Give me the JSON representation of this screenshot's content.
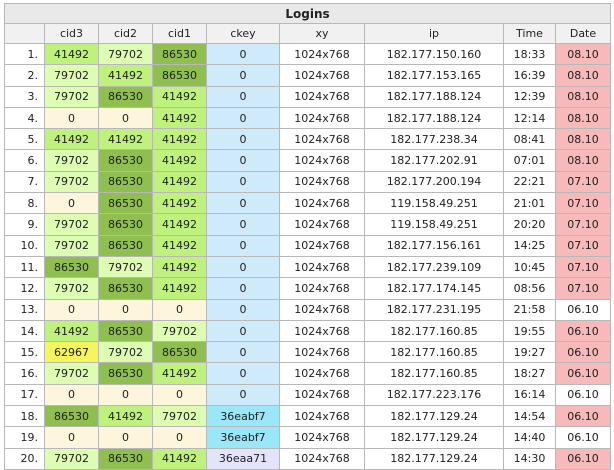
{
  "title": "Logins",
  "headers": [
    "",
    "cid3",
    "cid2",
    "cid1",
    "ckey",
    "xy",
    "ip",
    "Time",
    "Date"
  ],
  "colors": {
    "c86530": "#8fbf4f",
    "c41492": "#bff27c",
    "c79702": "#dcfdb2",
    "c62967": "#f6f65a",
    "c0": "#fdf6dd",
    "ckey": "#cfeafb",
    "ckey_36eabf7": "#99e7f9",
    "ckey_36eaa71": "#e3e3fb",
    "date_08": "#f7b9b9",
    "date_07": "#f7b9b9",
    "date_06_marked": "#f7b9b9"
  },
  "rows": [
    {
      "n": "1.",
      "cid3": "41492",
      "cid2": "79702",
      "cid1": "86530",
      "ckey": "0",
      "xy": "1024x768",
      "ip": "182.177.150.160",
      "time": "18:33",
      "date": "08.10",
      "date_marked": true
    },
    {
      "n": "2.",
      "cid3": "79702",
      "cid2": "41492",
      "cid1": "86530",
      "ckey": "0",
      "xy": "1024x768",
      "ip": "182.177.153.165",
      "time": "16:39",
      "date": "08.10",
      "date_marked": true
    },
    {
      "n": "3.",
      "cid3": "79702",
      "cid2": "86530",
      "cid1": "41492",
      "ckey": "0",
      "xy": "1024x768",
      "ip": "182.177.188.124",
      "time": "12:39",
      "date": "08.10",
      "date_marked": true
    },
    {
      "n": "4.",
      "cid3": "0",
      "cid2": "0",
      "cid1": "41492",
      "ckey": "0",
      "xy": "1024x768",
      "ip": "182.177.188.124",
      "time": "12:14",
      "date": "08.10",
      "date_marked": true
    },
    {
      "n": "5.",
      "cid3": "41492",
      "cid2": "41492",
      "cid1": "41492",
      "ckey": "0",
      "xy": "1024x768",
      "ip": "182.177.238.34",
      "time": "08:41",
      "date": "08.10",
      "date_marked": true
    },
    {
      "n": "6.",
      "cid3": "79702",
      "cid2": "86530",
      "cid1": "41492",
      "ckey": "0",
      "xy": "1024x768",
      "ip": "182.177.202.91",
      "time": "07:01",
      "date": "08.10",
      "date_marked": true
    },
    {
      "n": "7.",
      "cid3": "79702",
      "cid2": "86530",
      "cid1": "41492",
      "ckey": "0",
      "xy": "1024x768",
      "ip": "182.177.200.194",
      "time": "22:21",
      "date": "07.10",
      "date_marked": true
    },
    {
      "n": "8.",
      "cid3": "0",
      "cid2": "86530",
      "cid1": "41492",
      "ckey": "0",
      "xy": "1024x768",
      "ip": "119.158.49.251",
      "time": "21:01",
      "date": "07.10",
      "date_marked": true
    },
    {
      "n": "9.",
      "cid3": "79702",
      "cid2": "86530",
      "cid1": "41492",
      "ckey": "0",
      "xy": "1024x768",
      "ip": "119.158.49.251",
      "time": "20:20",
      "date": "07.10",
      "date_marked": true
    },
    {
      "n": "10.",
      "cid3": "79702",
      "cid2": "86530",
      "cid1": "41492",
      "ckey": "0",
      "xy": "1024x768",
      "ip": "182.177.156.161",
      "time": "14:25",
      "date": "07.10",
      "date_marked": true
    },
    {
      "n": "11.",
      "cid3": "86530",
      "cid2": "79702",
      "cid1": "41492",
      "ckey": "0",
      "xy": "1024x768",
      "ip": "182.177.239.109",
      "time": "10:45",
      "date": "07.10",
      "date_marked": true
    },
    {
      "n": "12.",
      "cid3": "79702",
      "cid2": "86530",
      "cid1": "41492",
      "ckey": "0",
      "xy": "1024x768",
      "ip": "182.177.174.145",
      "time": "08:56",
      "date": "07.10",
      "date_marked": true
    },
    {
      "n": "13.",
      "cid3": "0",
      "cid2": "0",
      "cid1": "0",
      "ckey": "0",
      "xy": "1024x768",
      "ip": "182.177.231.195",
      "time": "21:58",
      "date": "06.10",
      "date_marked": false
    },
    {
      "n": "14.",
      "cid3": "41492",
      "cid2": "86530",
      "cid1": "79702",
      "ckey": "0",
      "xy": "1024x768",
      "ip": "182.177.160.85",
      "time": "19:55",
      "date": "06.10",
      "date_marked": true
    },
    {
      "n": "15.",
      "cid3": "62967",
      "cid2": "79702",
      "cid1": "86530",
      "ckey": "0",
      "xy": "1024x768",
      "ip": "182.177.160.85",
      "time": "19:27",
      "date": "06.10",
      "date_marked": true
    },
    {
      "n": "16.",
      "cid3": "79702",
      "cid2": "86530",
      "cid1": "41492",
      "ckey": "0",
      "xy": "1024x768",
      "ip": "182.177.160.85",
      "time": "18:27",
      "date": "06.10",
      "date_marked": true
    },
    {
      "n": "17.",
      "cid3": "0",
      "cid2": "0",
      "cid1": "0",
      "ckey": "0",
      "xy": "1024x768",
      "ip": "182.177.223.176",
      "time": "16:14",
      "date": "06.10",
      "date_marked": false
    },
    {
      "n": "18.",
      "cid3": "86530",
      "cid2": "41492",
      "cid1": "79702",
      "ckey": "36eabf7",
      "xy": "1024x768",
      "ip": "182.177.129.24",
      "time": "14:54",
      "date": "06.10",
      "date_marked": true
    },
    {
      "n": "19.",
      "cid3": "0",
      "cid2": "0",
      "cid1": "0",
      "ckey": "36eabf7",
      "xy": "1024x768",
      "ip": "182.177.129.24",
      "time": "14:40",
      "date": "06.10",
      "date_marked": false
    },
    {
      "n": "20.",
      "cid3": "79702",
      "cid2": "86530",
      "cid1": "41492",
      "ckey": "36eaa71",
      "xy": "1024x768",
      "ip": "182.177.129.24",
      "time": "14:30",
      "date": "06.10",
      "date_marked": true
    }
  ]
}
